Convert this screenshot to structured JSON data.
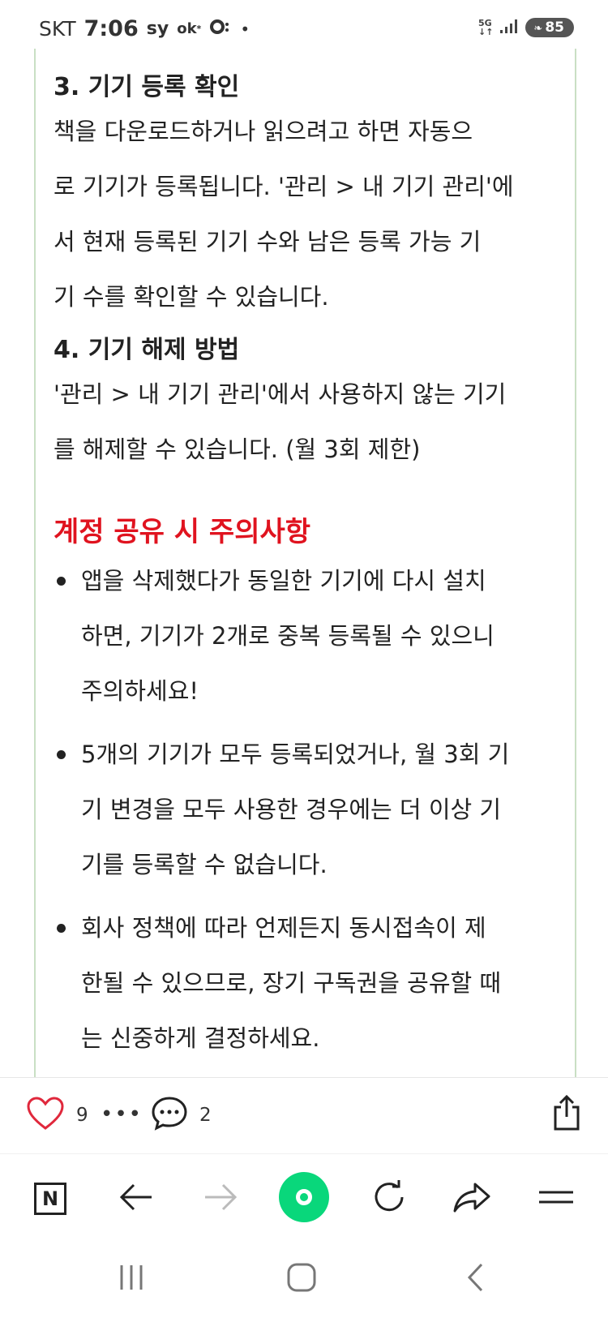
{
  "status_bar": {
    "carrier": "SKT",
    "time": "7:06",
    "indicators": "sy",
    "ok_label": "ok",
    "dot": "•",
    "net_5g": "5G",
    "net_arrows": "↓↑",
    "battery": "85"
  },
  "article": {
    "section3": {
      "title": "3. 기기 등록 확인",
      "lines": [
        "책을 다운로드하거나 읽으려고 하면 자동으",
        "로 기기가 등록됩니다. '관리 > 내 기기 관리'에",
        "서 현재 등록된 기기 수와 남은 등록 가능 기",
        "기 수를 확인할 수 있습니다."
      ]
    },
    "section4": {
      "title": "4. 기기 해제 방법",
      "lines": [
        "'관리 > 내 기기 관리'에서 사용하지 않는 기기",
        "를 해제할 수 있습니다. (월 3회 제한)"
      ]
    },
    "caution": {
      "title": "계정 공유 시 주의사항",
      "bullets": [
        {
          "lines": [
            "앱을 삭제했다가 동일한 기기에 다시 설치",
            "하면, 기기가 2개로 중복 등록될 수 있으니",
            "주의하세요!"
          ]
        },
        {
          "lines": [
            "5개의 기기가 모두 등록되었거나, 월 3회 기",
            "기 변경을 모두 사용한 경우에는 더 이상 기",
            "기를 등록할 수 없습니다."
          ]
        },
        {
          "lines": [
            "회사 정책에 따라 언제든지 동시접속이 제",
            "한될 수 있으므로, 장기 구독권을 공유할 때",
            "는 신중하게 결정하세요."
          ]
        }
      ]
    }
  },
  "action_bar": {
    "like_count": "9",
    "more": "•••",
    "comment_count": "2"
  },
  "browser_bar": {
    "home_label": "N"
  },
  "colors": {
    "accent_red": "#e0131f",
    "accent_green": "#09d77b",
    "heart_red": "#e0283c",
    "border_green": "#c9dfc4"
  },
  "icons": [
    "heart-icon",
    "more-icon",
    "comment-icon",
    "share-icon",
    "naver-home-icon",
    "back-icon",
    "forward-icon",
    "green-dot-icon",
    "refresh-icon",
    "forward-share-icon",
    "menu-icon",
    "recent-apps-icon",
    "home-icon",
    "back-nav-icon"
  ]
}
